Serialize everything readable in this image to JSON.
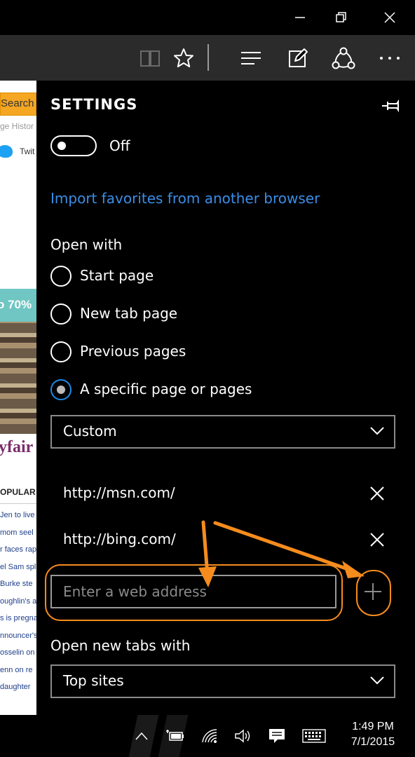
{
  "window": {
    "buttons": [
      "minimize",
      "restore",
      "close"
    ]
  },
  "toolbar": {
    "icons": [
      "reading-view-icon",
      "favorite-star-icon",
      "hub-icon",
      "web-note-icon",
      "share-icon",
      "more-icon"
    ]
  },
  "background_page": {
    "search_text": "Search",
    "history_text": "ge Histor",
    "twitter_text": "Twit",
    "ad_discount": "o 70%",
    "ad_brand": "yfair",
    "popular_label": "OPULAR",
    "headlines": [
      "Jen to live",
      "mom seel",
      "r faces rap",
      "el Sam spl",
      "Burke ste",
      "oughlin's a",
      "s is pregna",
      "nnouncer's",
      "osselin on",
      "enn on re",
      "daughter"
    ]
  },
  "settings": {
    "title": "SETTINGS",
    "toggle_state": "Off",
    "import_link": "Import favorites from another browser",
    "open_with_label": "Open with",
    "open_with_options": [
      {
        "label": "Start page",
        "checked": false
      },
      {
        "label": "New tab page",
        "checked": false
      },
      {
        "label": "Previous pages",
        "checked": false
      },
      {
        "label": "A specific page or pages",
        "checked": true
      }
    ],
    "pages_select": "Custom",
    "urls": [
      "http://msn.com/",
      "http://bing.com/"
    ],
    "address_placeholder": "Enter a web address",
    "new_tabs_label": "Open new tabs with",
    "new_tabs_select": "Top sites",
    "accent_color": "#3a8ee8",
    "annotation_color": "#f68c1e"
  },
  "taskbar": {
    "time": "1:49 PM",
    "date": "7/1/2015"
  }
}
